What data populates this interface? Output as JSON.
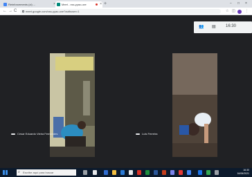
{
  "browser": {
    "tabs": [
      {
        "label": "Reinforcements (cl) ...",
        "favicon": "meet-grid-icon",
        "active": false
      },
      {
        "label": "Meet - xss-yyac-uxe",
        "favicon": "meet-icon",
        "active": true
      }
    ],
    "address": "meet.google.com/xss-yyac-uxe?authuser=1",
    "window_controls": [
      "−",
      "□",
      "×"
    ],
    "nav": {
      "back": "←",
      "forward": "→",
      "reload": "C"
    }
  },
  "meet": {
    "time": "16:30",
    "participants": [
      {
        "name": "Cesar Eduardo Vieira Fernandes"
      },
      {
        "name": "Luis Ferreira"
      }
    ]
  },
  "taskbar": {
    "search_placeholder": "Escribe aquí para buscar",
    "tray": {
      "time": "16:30",
      "date": "16/06/2021"
    }
  },
  "colors": {
    "meet_background": "#202124",
    "taskbar": "#0c1a2c",
    "accent_blue": "#3b8ee8"
  }
}
